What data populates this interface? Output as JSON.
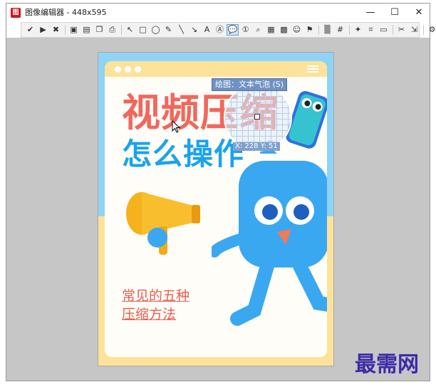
{
  "window": {
    "title": "图像编辑器 - 448x595",
    "app_icon_glyph": "图",
    "minimize": "—",
    "maximize": "☐",
    "close": "✕"
  },
  "toolbar": {
    "items": [
      {
        "icon": "check-icon",
        "glyph": "✔"
      },
      {
        "icon": "play-icon",
        "glyph": "▶"
      },
      {
        "icon": "cancel-icon",
        "glyph": "✖"
      },
      {
        "icon": "save-icon",
        "glyph": "▣"
      },
      {
        "icon": "save-as-icon",
        "glyph": "▤"
      },
      {
        "icon": "copy-icon",
        "glyph": "❐"
      },
      {
        "icon": "print-icon",
        "glyph": "⎙"
      },
      {
        "icon": "pointer-icon",
        "glyph": "↖"
      },
      {
        "icon": "rectangle-icon",
        "glyph": "□"
      },
      {
        "icon": "ellipse-icon",
        "glyph": "◯"
      },
      {
        "icon": "pen-icon",
        "glyph": "✎"
      },
      {
        "icon": "line-icon",
        "glyph": "╲"
      },
      {
        "icon": "arrow-icon",
        "glyph": "↘"
      },
      {
        "icon": "text-icon",
        "glyph": "A"
      },
      {
        "icon": "textbox-icon",
        "glyph": "Ⓐ"
      },
      {
        "icon": "speech-bubble-icon",
        "glyph": "💬",
        "active": true
      },
      {
        "icon": "step-counter-icon",
        "glyph": "①"
      },
      {
        "icon": "magnifier-icon",
        "glyph": "⌕"
      },
      {
        "icon": "highlight-icon",
        "glyph": "▦"
      },
      {
        "icon": "image-icon",
        "glyph": "▩"
      },
      {
        "icon": "emoji-icon",
        "glyph": "☺"
      },
      {
        "icon": "stamp-icon",
        "glyph": "⚑"
      },
      {
        "icon": "blur-icon",
        "glyph": "▒"
      },
      {
        "icon": "grid-icon",
        "glyph": "#"
      },
      {
        "icon": "magic-icon",
        "glyph": "✦"
      },
      {
        "icon": "crop-icon",
        "glyph": "⌗"
      },
      {
        "icon": "frame-icon",
        "glyph": "▭"
      },
      {
        "icon": "tools-icon",
        "glyph": "✂"
      },
      {
        "icon": "export-icon",
        "glyph": "⇲"
      },
      {
        "icon": "settings-icon",
        "glyph": "⚙"
      }
    ]
  },
  "overlay": {
    "tooltip": "绘图：文本气泡 (S)",
    "coords": "X: 228 Y: 51"
  },
  "poster": {
    "heading1": "视频压缩",
    "heading2": "怎么操作",
    "subtitle_line1": "常见的五种",
    "subtitle_line2": "压缩方法",
    "colors": {
      "top_band": "#8fd3f5",
      "bottom_band": "#fde29a",
      "heading1": "#f0685c",
      "heading2": "#1aa3ec",
      "subtitle": "#ee5c4c",
      "mascot": "#3aa8f0"
    }
  },
  "watermark": "最需网"
}
